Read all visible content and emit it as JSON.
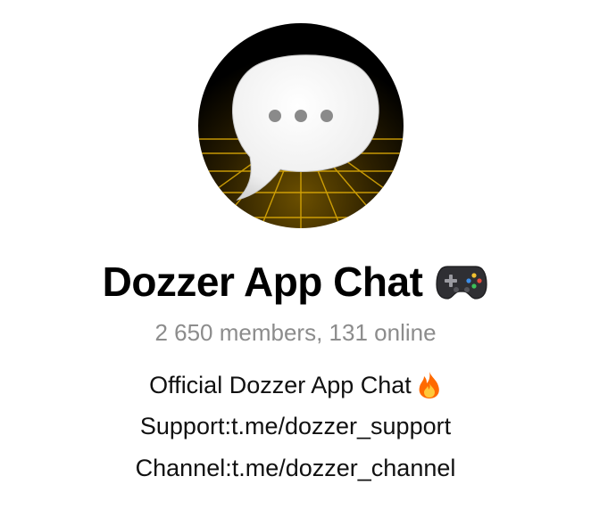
{
  "chat": {
    "title": "Dozzer App Chat",
    "title_emoji": "gamepad-emoji",
    "stats": "2 650 members, 131 online",
    "description": {
      "line1": "Official Dozzer App Chat",
      "line1_emoji": "fire-emoji",
      "line2_label": "Support: ",
      "line2_link": "t.me/dozzer_support",
      "line3_label": "Channel: ",
      "line3_link": "t.me/dozzer_channel"
    }
  },
  "avatar": {
    "icon": "speech-bubble-ellipsis-icon",
    "background_color": "#000000",
    "grid_color": "#e3b006",
    "bubble_color": "#f2f2f2",
    "dots_color": "#8a8a8a"
  },
  "colors": {
    "title": "#000000",
    "stats": "#8c8c8c",
    "text": "#111111",
    "fire": "#ff6a00"
  }
}
